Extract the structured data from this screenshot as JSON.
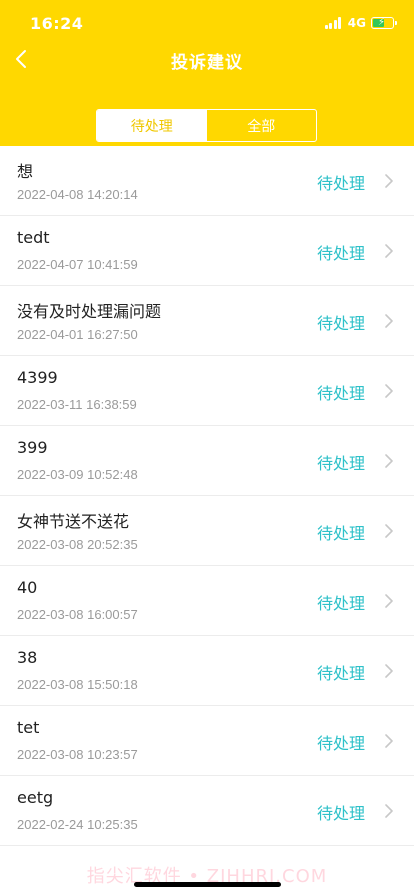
{
  "status_bar": {
    "time": "16:24",
    "network": "4G",
    "battery_level": 0.6
  },
  "header": {
    "title": "投诉建议"
  },
  "tabs": [
    {
      "label": "待处理",
      "selected": true
    },
    {
      "label": "全部",
      "selected": false
    }
  ],
  "colors": {
    "header_bg": "#FFD800",
    "status_text": "#2EC1C9",
    "active_tab_text": "#F0C800"
  },
  "items": [
    {
      "title": "想",
      "date": "2022-04-08 14:20:14",
      "status": "待处理"
    },
    {
      "title": "tedt",
      "date": "2022-04-07 10:41:59",
      "status": "待处理"
    },
    {
      "title": "没有及时处理漏问题",
      "date": "2022-04-01 16:27:50",
      "status": "待处理"
    },
    {
      "title": "4399",
      "date": "2022-03-11 16:38:59",
      "status": "待处理"
    },
    {
      "title": "399",
      "date": "2022-03-09 10:52:48",
      "status": "待处理"
    },
    {
      "title": "女神节送不送花",
      "date": "2022-03-08 20:52:35",
      "status": "待处理"
    },
    {
      "title": "40",
      "date": "2022-03-08 16:00:57",
      "status": "待处理"
    },
    {
      "title": "38",
      "date": "2022-03-08 15:50:18",
      "status": "待处理"
    },
    {
      "title": "tet",
      "date": "2022-03-08 10:23:57",
      "status": "待处理"
    },
    {
      "title": "eetg",
      "date": "2022-02-24 10:25:35",
      "status": "待处理"
    }
  ],
  "watermark": "指尖汇软件 • ZJHHRJ.COM"
}
